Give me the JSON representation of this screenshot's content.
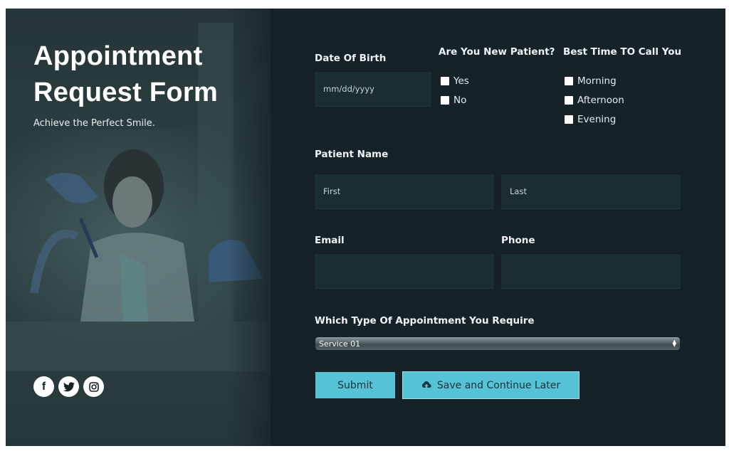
{
  "hero": {
    "title_line1": "Appointment",
    "title_line2": "Request Form",
    "subtitle": "Achieve the Perfect Smile.",
    "social": [
      {
        "name": "facebook-icon",
        "glyph": "f"
      },
      {
        "name": "twitter-icon",
        "glyph": "🐦"
      },
      {
        "name": "instagram-icon",
        "glyph": "◎"
      }
    ]
  },
  "form": {
    "dob": {
      "label": "Date Of Birth",
      "placeholder": "mm/dd/yyyy"
    },
    "new_patient": {
      "label": "Are You New Patient?",
      "options": [
        "Yes",
        "No"
      ]
    },
    "best_time": {
      "label": "Best Time TO Call You",
      "options": [
        "Morning",
        "Afternoon",
        "Evening"
      ]
    },
    "patient_name": {
      "label": "Patient Name",
      "first_placeholder": "First",
      "last_placeholder": "Last"
    },
    "email": {
      "label": "Email",
      "value": ""
    },
    "phone": {
      "label": "Phone",
      "value": ""
    },
    "appointment_type": {
      "label": "Which Type Of Appointment You Require",
      "selected": "Service 01"
    },
    "submit_label": "Submit",
    "save_label": "Save and Continue Later",
    "save_icon": "cloud-upload-icon"
  },
  "colors": {
    "panel_bg": "#152328",
    "field_bg": "#1a2d31",
    "button_accent": "#55c2d5"
  }
}
